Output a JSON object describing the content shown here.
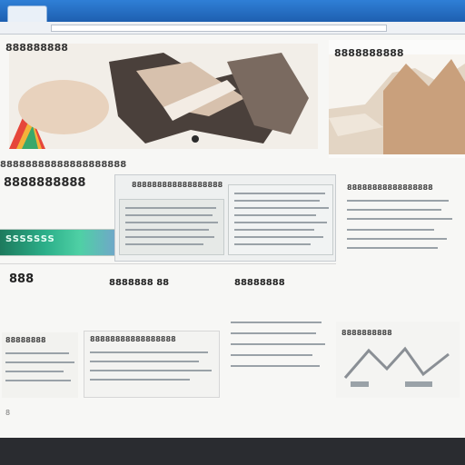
{
  "browser": {
    "tab_label": "",
    "address": ""
  },
  "nav": {
    "brand": "888888888"
  },
  "hero": {
    "colors": {
      "skin": "#d6b69a",
      "dark": "#3a3230",
      "accent": "#e6463a"
    }
  },
  "side_card": {
    "title": "8888888888",
    "lines": [
      "",
      "",
      ""
    ]
  },
  "section": {
    "title": "88888888888888888888",
    "subhead": "8888888888"
  },
  "banner": {
    "label": "SSSSSSS",
    "color": "#2cb08a"
  },
  "panels": {
    "center_title": "888888888888888888",
    "right_title": "88888888888888"
  },
  "right_column": {
    "title": "88888888888888888"
  },
  "stats": {
    "left_value": "888",
    "middle_value": "8888888",
    "middle_suffix": "88",
    "right_value": "88888888"
  },
  "lower": {
    "left_title": "88888888",
    "mid_title": "88888888888888888",
    "right_title": "8888888888"
  },
  "footer": {
    "marker": "8"
  }
}
